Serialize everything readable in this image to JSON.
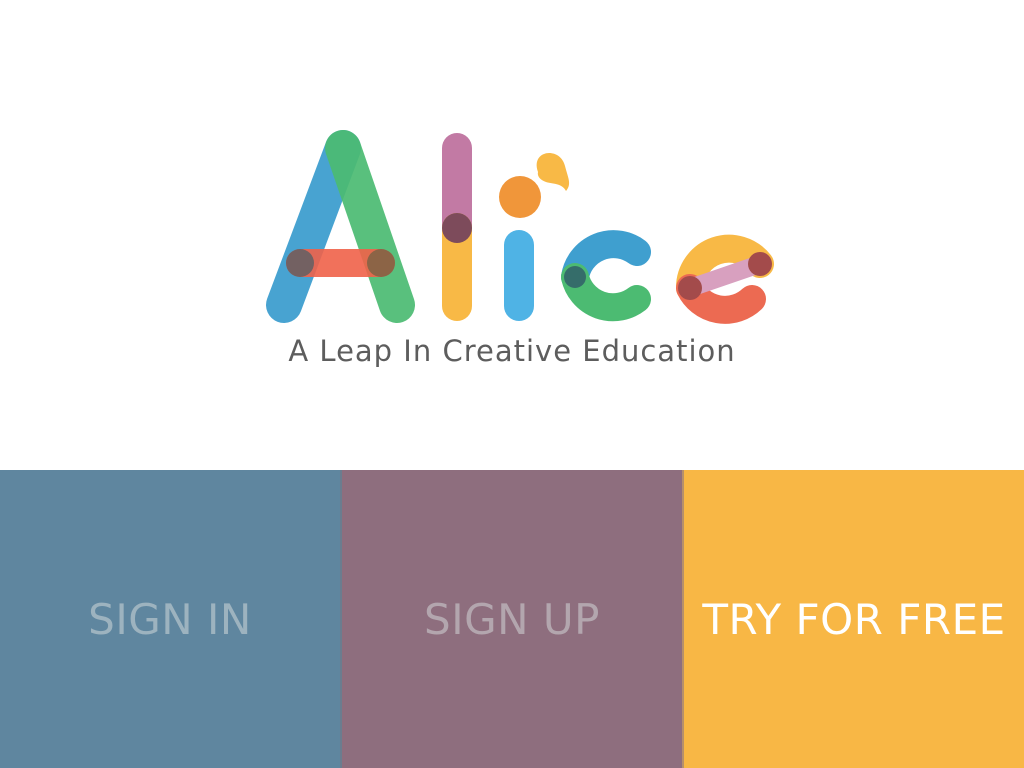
{
  "logo": {
    "wordmark": "Alice",
    "tagline": "A Leap In Creative Education",
    "colors": {
      "blue": "#3f9fcf",
      "green": "#4cbb72",
      "red": "#f0624a",
      "pink": "#c27aa4",
      "yellow": "#f8b946",
      "orange": "#f0963a",
      "sky": "#4fb3e5",
      "coral": "#ec6a52",
      "dot": "#7d4b5b"
    }
  },
  "actions": [
    {
      "label": "SIGN IN",
      "color": "#5f869f"
    },
    {
      "label": "SIGN UP",
      "color": "#8e6e7e"
    },
    {
      "label": "TRY FOR FREE",
      "color": "#f8b745"
    }
  ]
}
